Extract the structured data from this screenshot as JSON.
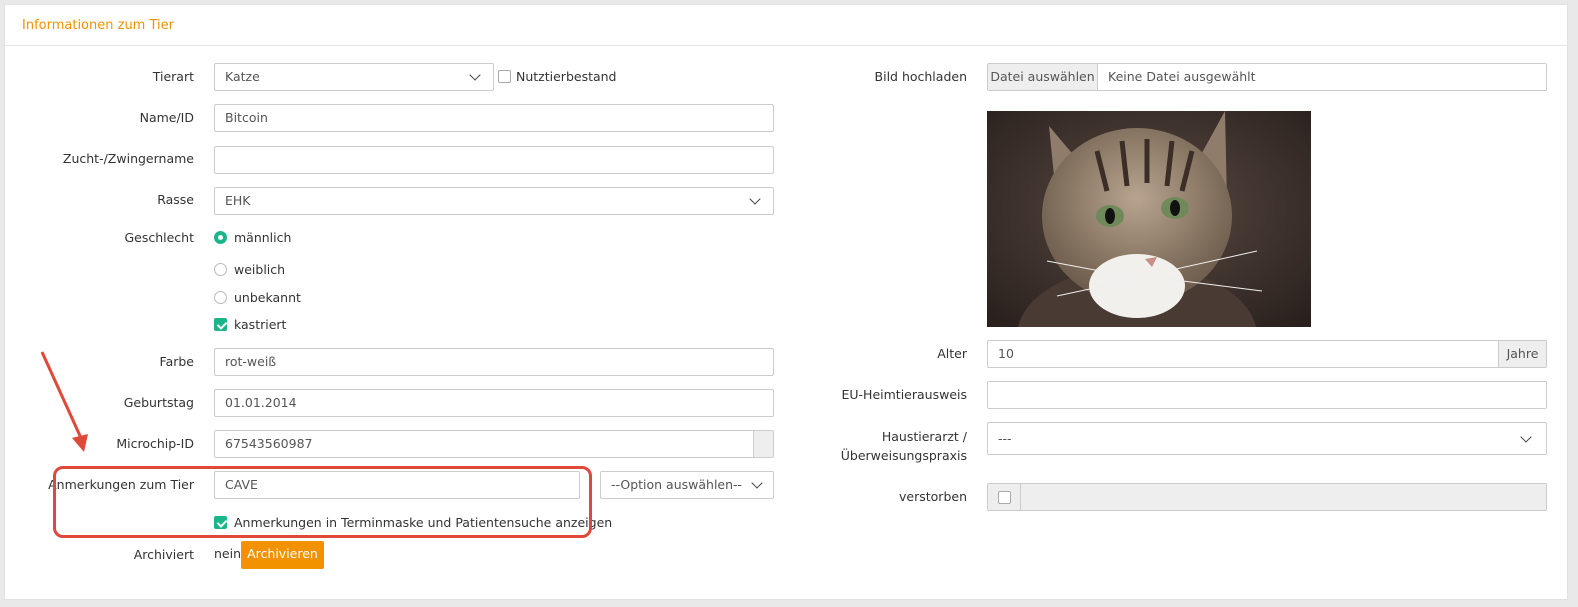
{
  "panel": {
    "title": "Informationen zum Tier"
  },
  "form": {
    "tierart": {
      "label": "Tierart",
      "value": "Katze"
    },
    "nutztier": {
      "label": "Nutztierbestand",
      "checked": false
    },
    "name": {
      "label": "Name/ID",
      "value": "Bitcoin"
    },
    "zucht": {
      "label": "Zucht-/Zwingername",
      "value": ""
    },
    "rasse": {
      "label": "Rasse",
      "value": "EHK"
    },
    "geschlecht": {
      "label": "Geschlecht",
      "options": [
        "männlich",
        "weiblich",
        "unbekannt"
      ],
      "selected": "männlich"
    },
    "kastriert": {
      "label": "kastriert",
      "checked": true
    },
    "farbe": {
      "label": "Farbe",
      "value": "rot-weiß"
    },
    "geburtstag": {
      "label": "Geburtstag",
      "value": "01.01.2014"
    },
    "microchip": {
      "label": "Microchip-ID",
      "value": "67543560987"
    },
    "anmerkungen": {
      "label": "Anmerkungen zum Tier",
      "value": "CAVE",
      "option_select": "--Option auswählen--",
      "show_label": "Anmerkungen in Terminmaske und Patientensuche anzeigen",
      "show_checked": true
    },
    "archiviert": {
      "label": "Archiviert",
      "value": "nein",
      "button": "Archivieren"
    },
    "bild": {
      "label": "Bild hochladen",
      "button": "Datei auswählen",
      "status": "Keine Datei ausgewählt"
    },
    "alter": {
      "label": "Alter",
      "value": "10",
      "unit": "Jahre"
    },
    "eu": {
      "label": "EU-Heimtierausweis",
      "value": ""
    },
    "haustierarzt": {
      "label_line1": "Haustierarzt /",
      "label_line2": "Überweisungspraxis",
      "value": "---"
    },
    "verstorben": {
      "label": "verstorben",
      "checked": false
    }
  },
  "colors": {
    "accent": "#f39200",
    "check": "#1bb58c",
    "annotation": "#e0483a"
  }
}
